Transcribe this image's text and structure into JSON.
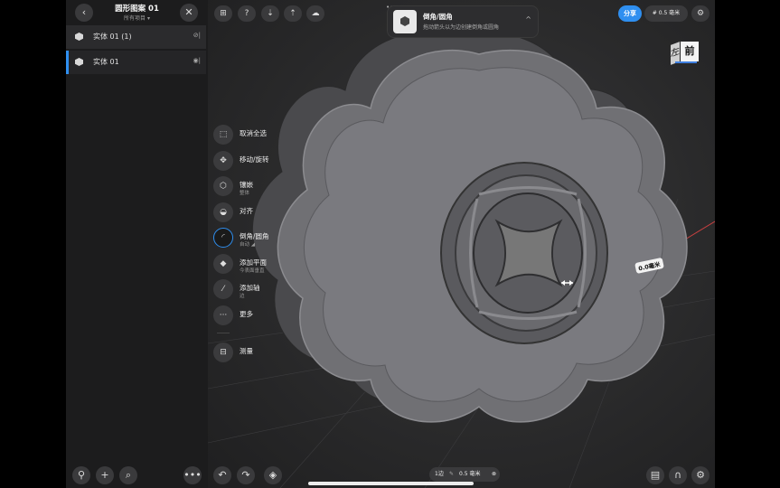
{
  "sidebar": {
    "back_icon": "chevron-left-icon",
    "title": "圆形图案 01",
    "subtitle": "所有项目 ▾",
    "close_icon": "close-icon",
    "items": [
      {
        "label": "实体 01 (1)",
        "icon": "hidden-eye-icon",
        "selected": false
      },
      {
        "label": "实体 01",
        "icon": "eye-icon",
        "selected": true
      }
    ]
  },
  "tools": [
    {
      "label": "取消全选",
      "sub": "",
      "icon": "deselect-icon"
    },
    {
      "label": "移动/旋转",
      "sub": "",
      "icon": "move-rotate-icon"
    },
    {
      "label": "镶嵌",
      "sub": "整体",
      "icon": "hexagon-icon"
    },
    {
      "label": "对齐",
      "sub": "",
      "icon": "align-icon"
    },
    {
      "label": "倒角/圆角",
      "sub": "自动 ◢",
      "icon": "fillet-icon",
      "active": true
    },
    {
      "label": "添加平面",
      "sub": "今表面垂直",
      "icon": "plane-icon"
    },
    {
      "label": "添加轴",
      "sub": "边",
      "icon": "axis-icon"
    },
    {
      "label": "更多",
      "sub": "",
      "icon": "more-icon"
    },
    {
      "label": "测量",
      "sub": "",
      "icon": "measure-icon"
    }
  ],
  "toolbar": {
    "buttons": [
      "grid-view-icon",
      "help-icon",
      "download-icon",
      "share-out-icon",
      "cloud-icon"
    ],
    "share_label": "分享",
    "grid_label": "# 0.5 毫米",
    "settings_icon": "gear-icon"
  },
  "notice": {
    "title": "倒角/圆角",
    "subtitle": "拖动箭头以为边创建倒角或圆角",
    "chevron": "^"
  },
  "viewcube": {
    "left": "左",
    "front": "前"
  },
  "dimension": "0.0毫米",
  "bottom": {
    "edges_label": "1边",
    "value": "0.5 毫米",
    "left_buttons": [
      "pin-icon",
      "add-icon",
      "search-icon"
    ],
    "right_buttons": [
      "undo-icon",
      "redo-icon",
      "layers-icon"
    ],
    "end_buttons": [
      "library-icon",
      "magnet-icon",
      "settings-icon"
    ],
    "more_icon": "more-icon"
  }
}
